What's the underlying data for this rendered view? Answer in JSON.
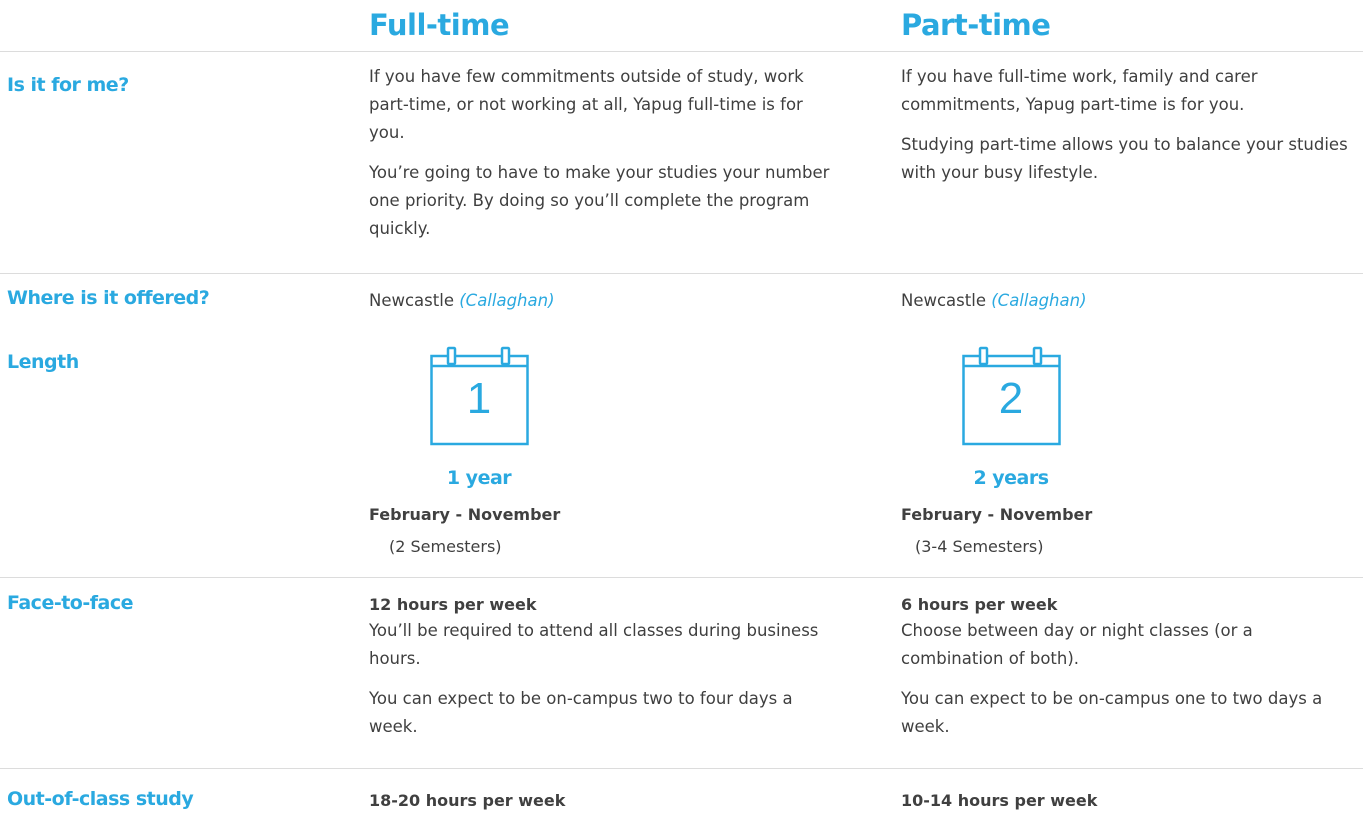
{
  "columns": {
    "full_time": "Full-time",
    "part_time": "Part-time"
  },
  "rows": {
    "for_me": {
      "label": "Is it for me?",
      "full_time": [
        "If you have few commitments outside of study, work part-time, or not working at all, Yapug full-time is for you.",
        "You’re going to have to make your studies your number one priority. By doing so you’ll complete the program quickly."
      ],
      "part_time": [
        "If you have full-time work, family and carer commitments, Yapug part-time is for you.",
        "Studying part-time allows you to balance your studies with your busy lifestyle."
      ]
    },
    "offered": {
      "label": "Where is it offered?",
      "full_time": {
        "city": "Newcastle",
        "campus": "(Callaghan)"
      },
      "part_time": {
        "city": "Newcastle",
        "campus": "(Callaghan)"
      }
    },
    "length": {
      "label": "Length",
      "full_time": {
        "calendar_number": "1",
        "duration": "1 year",
        "months": "February - November",
        "semesters": "(2 Semesters)"
      },
      "part_time": {
        "calendar_number": "2",
        "duration": "2 years",
        "months": "February - November",
        "semesters": "(3-4 Semesters)"
      }
    },
    "face_to_face": {
      "label": "Face-to-face",
      "full_time": {
        "hours": "12 hours per week",
        "text": [
          "You’ll be required to attend all classes during business hours.",
          "You can expect to be on-campus two to four days a week."
        ]
      },
      "part_time": {
        "hours": "6 hours per week",
        "text": [
          "Choose between day or night classes (or a combination of both).",
          "You can expect to be on-campus one to two days a week."
        ]
      }
    },
    "out_of_class": {
      "label": "Out-of-class study",
      "full_time": {
        "hours": "18-20 hours per week"
      },
      "part_time": {
        "hours": "10-14 hours per week"
      }
    }
  },
  "icons": {
    "calendar": "calendar-icon"
  },
  "colors": {
    "accent": "#2aa9e0",
    "text": "#3f3f3f",
    "divider": "#dcdcdc"
  }
}
